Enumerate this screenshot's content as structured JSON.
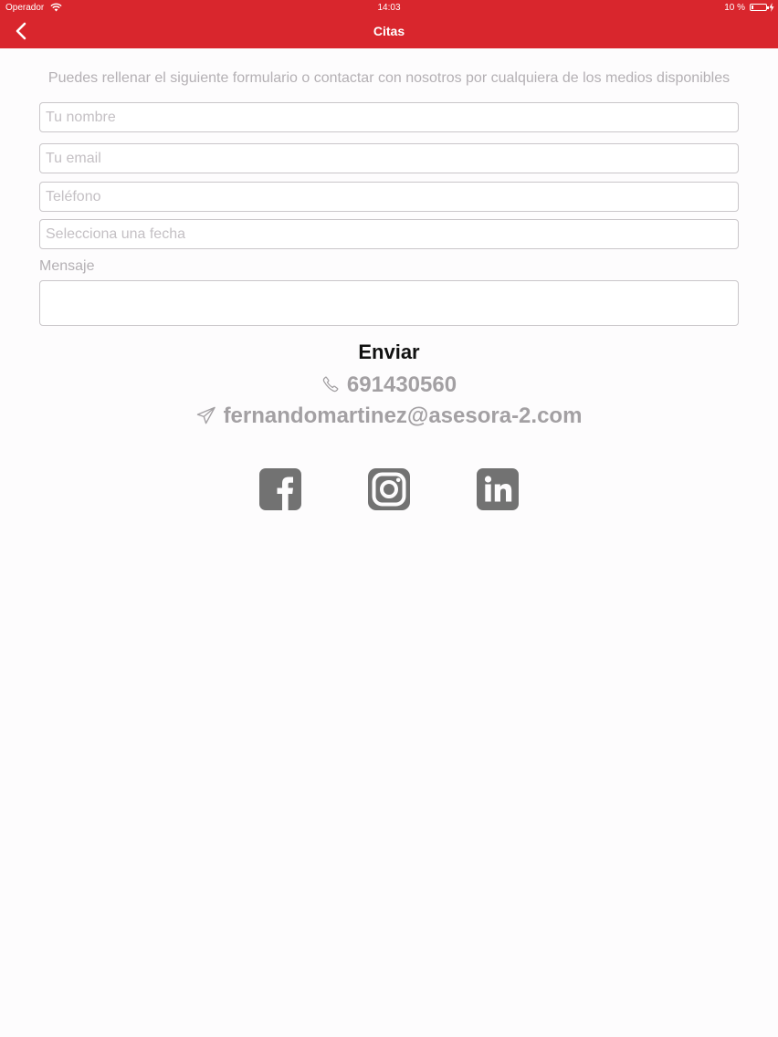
{
  "status_bar": {
    "carrier": "Operador",
    "time": "14:03",
    "battery": "10 %"
  },
  "nav": {
    "title": "Citas"
  },
  "form": {
    "intro": "Puedes rellenar el siguiente formulario o contactar con nosotros por cualquiera de los medios disponibles",
    "name_placeholder": "Tu nombre",
    "email_placeholder": "Tu email",
    "phone_placeholder": "Teléfono",
    "date_placeholder": "Selecciona una fecha",
    "message_label": "Mensaje",
    "submit_label": "Enviar"
  },
  "contact": {
    "phone": "691430560",
    "email": "fernandomartinez@asesora-2.com"
  },
  "social": {
    "items": [
      "facebook-icon",
      "instagram-icon",
      "linkedin-icon"
    ]
  },
  "colors": {
    "header": "#d9262d",
    "muted_text": "#b4b0b4",
    "contact_text": "#a3a0a3",
    "social_icon": "#727272"
  }
}
